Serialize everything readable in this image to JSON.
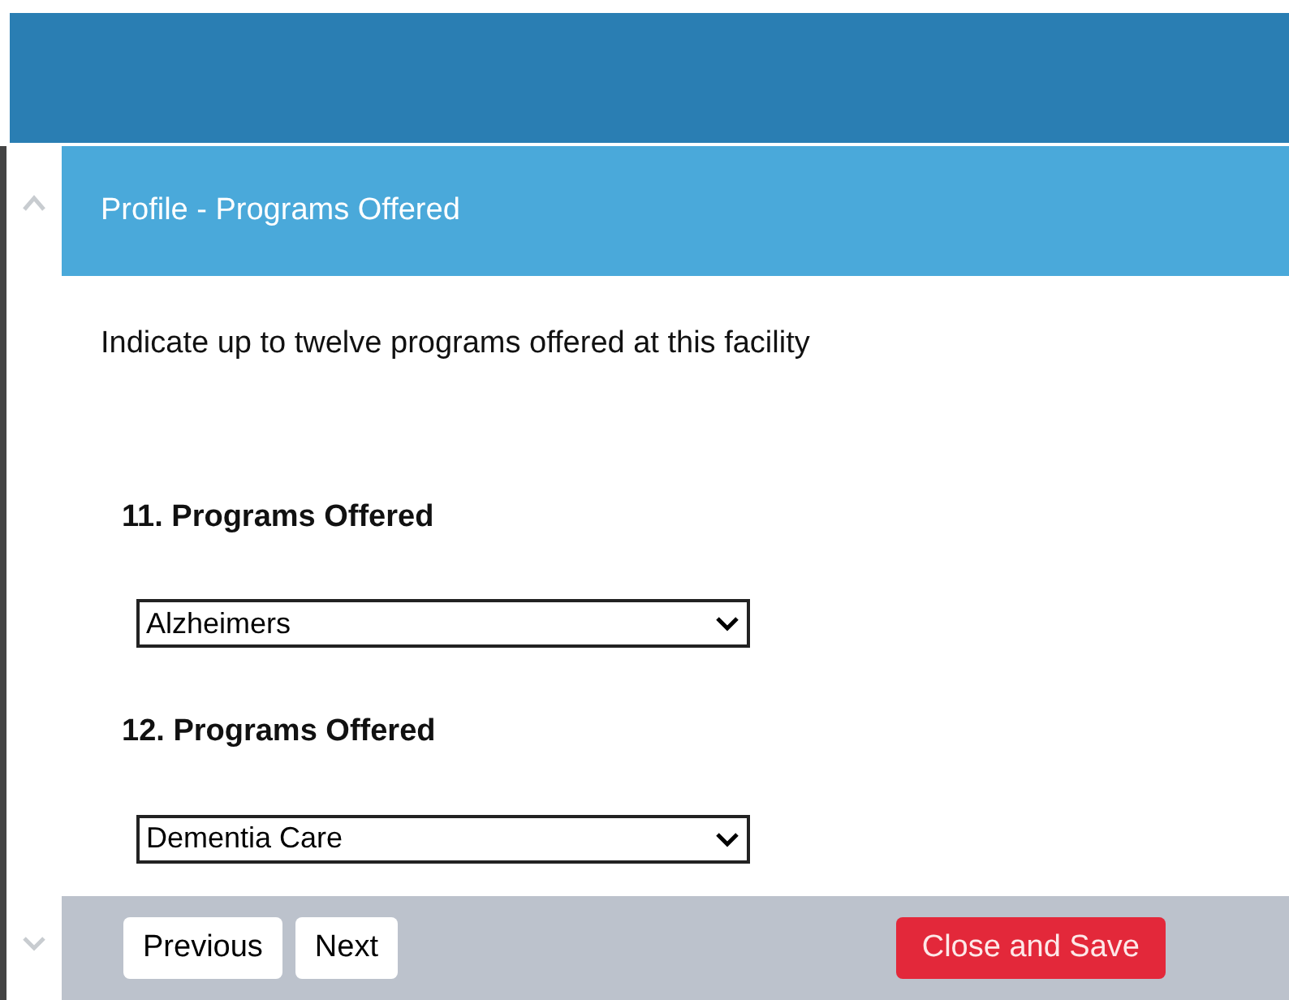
{
  "panel": {
    "title": "Profile - Programs Offered"
  },
  "instructions": "Indicate up to twelve programs offered at this facility",
  "fields": [
    {
      "label": "11. Programs Offered",
      "value": "Alzheimers"
    },
    {
      "label": "12. Programs Offered",
      "value": "Dementia Care"
    }
  ],
  "footer": {
    "buttons": [
      {
        "label": "Previous",
        "kind": "nav"
      },
      {
        "label": "Next",
        "kind": "nav"
      },
      {
        "label": "Close and Save",
        "kind": "primary"
      }
    ]
  }
}
